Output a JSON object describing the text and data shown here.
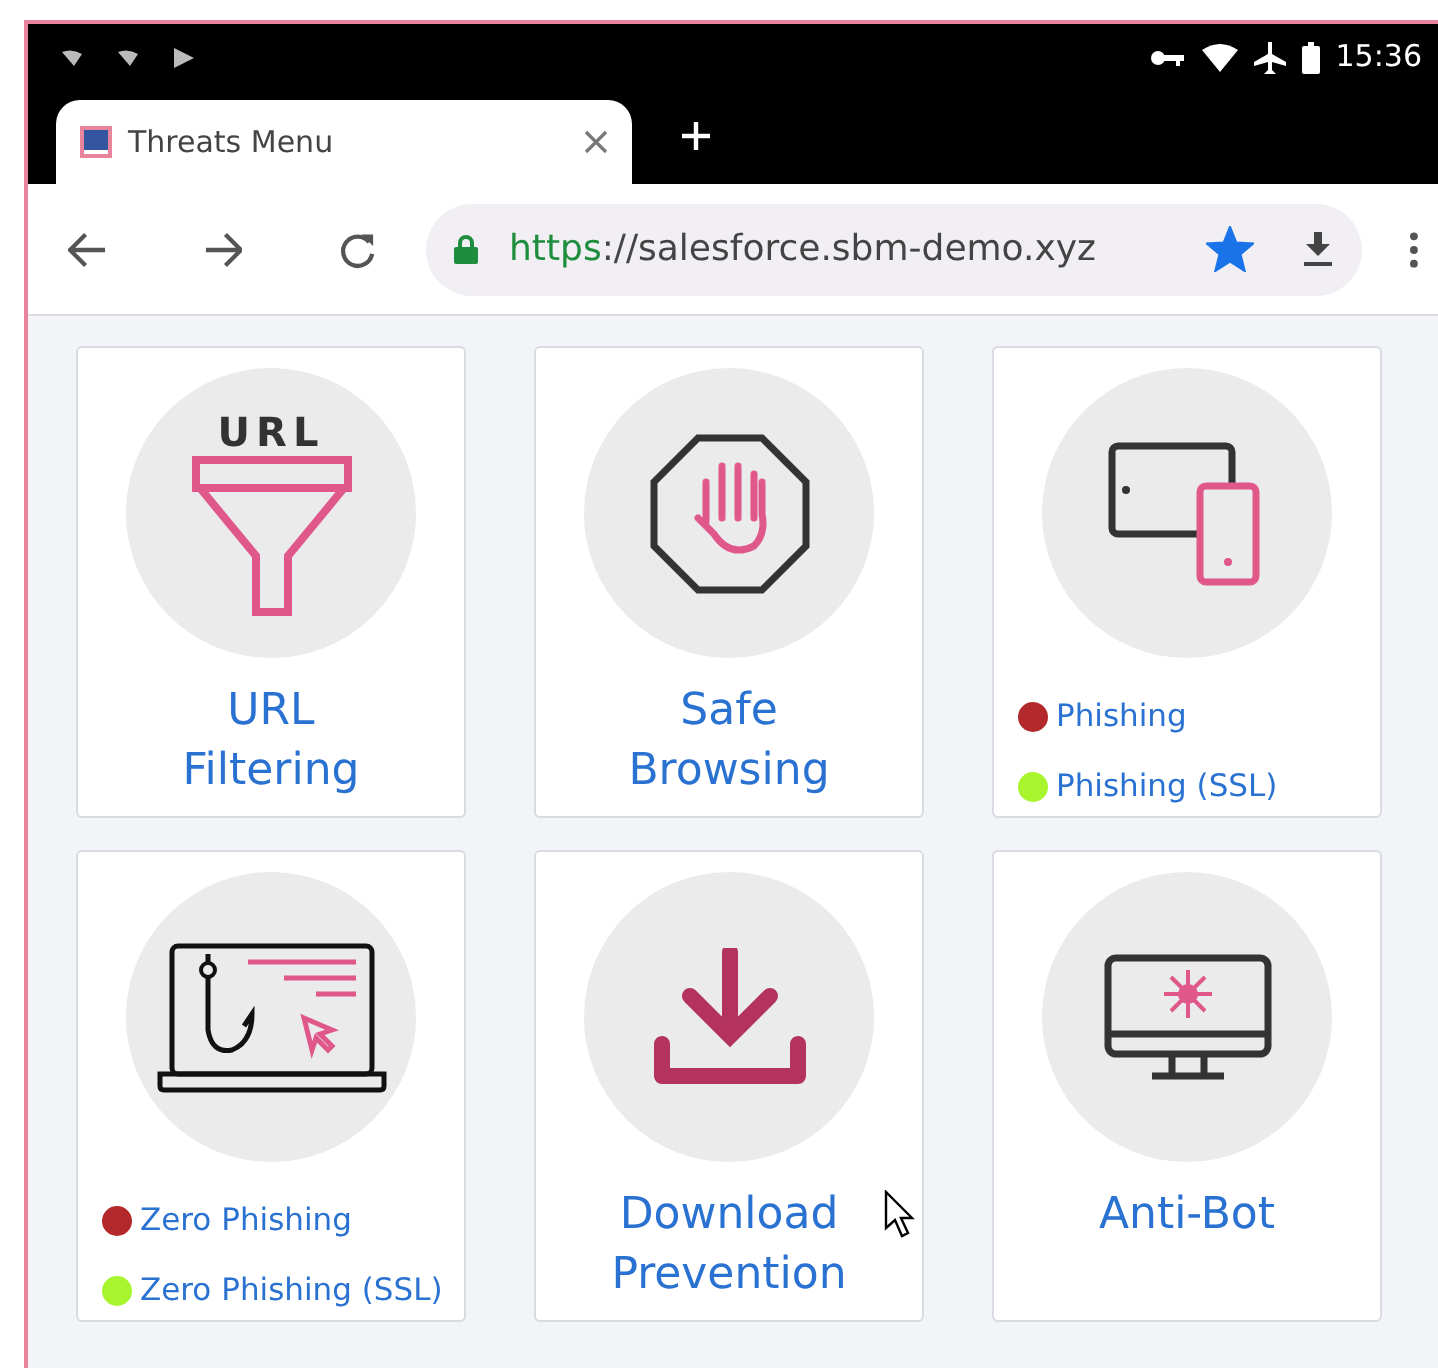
{
  "status_bar": {
    "time": "15:36"
  },
  "browser": {
    "tab": {
      "title": "Threats Menu",
      "selected": true
    },
    "url": {
      "scheme": "https",
      "rest": "://salesforce.sbm-demo.xyz"
    },
    "bookmarked": true
  },
  "cards": [
    {
      "kind": "title",
      "icon_text": "URL",
      "title": "URL Filtering"
    },
    {
      "kind": "title",
      "title": "Safe Browsing"
    },
    {
      "kind": "legend",
      "items": [
        {
          "label": "Phishing",
          "color": "#b3282a"
        },
        {
          "label": "Phishing (SSL)",
          "color": "#a8f52e"
        }
      ]
    },
    {
      "kind": "legend",
      "items": [
        {
          "label": "Zero Phishing",
          "color": "#b3282a"
        },
        {
          "label": "Zero Phishing (SSL)",
          "color": "#a8f52e"
        }
      ]
    },
    {
      "kind": "title",
      "title": "Download Prevention"
    },
    {
      "kind": "title",
      "title": "Anti-Bot"
    }
  ]
}
